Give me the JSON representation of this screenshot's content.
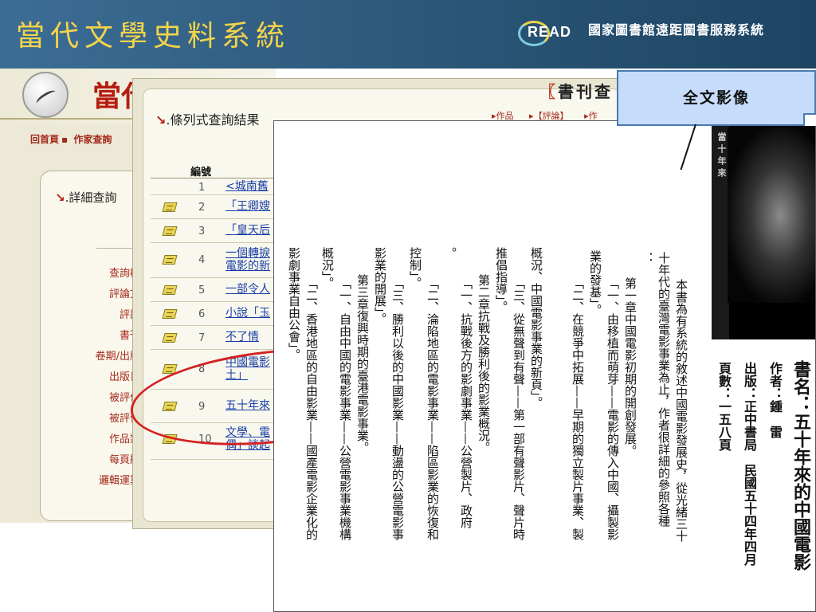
{
  "header": {
    "title": "當代文學史料系統",
    "logo_text": "READ",
    "agency": "國家圖書館遠距圖書服務系統"
  },
  "left_panel": {
    "site_title": "當代",
    "breadcrumb": [
      "回首頁",
      "作家查詢"
    ],
    "detail_heading": "詳細查詢",
    "field_labels": [
      "查詢模",
      "評論文",
      "評論",
      "書刊",
      "卷期/出版",
      "出版日",
      "被評作",
      "被評作",
      "作品類",
      "每頁顯",
      "邏輯運算"
    ]
  },
  "results_panel": {
    "heading": "條列式查詢結果",
    "book_tag": "書刊查",
    "tabs": [
      "作品",
      "【評論】",
      "作"
    ],
    "col_number": "編號",
    "rows": [
      {
        "no": "1",
        "title": "<城南舊",
        "icon": false
      },
      {
        "no": "2",
        "title": "「王卿嫂",
        "icon": true
      },
      {
        "no": "3",
        "title": "「皇天后",
        "icon": true
      },
      {
        "no": "4",
        "title": "一個轉捩\n電影的新",
        "icon": true
      },
      {
        "no": "5",
        "title": "一部令人",
        "icon": true
      },
      {
        "no": "6",
        "title": "小說「玉",
        "icon": true
      },
      {
        "no": "7",
        "title": "不了情",
        "icon": true
      },
      {
        "no": "8",
        "title": "中國電影\n土」",
        "icon": true
      },
      {
        "no": "9",
        "title": "五十年來",
        "icon": true
      },
      {
        "no": "10",
        "title": "文學、電\n偶」談起",
        "icon": true
      }
    ]
  },
  "document": {
    "book_title": "書名：五十年來的中國電影",
    "author": "作者：鍾　雷",
    "publisher": "出版：正中書局　民國五十四年四月",
    "pages": "頁數：一五八頁",
    "columns": [
      "本書為有系統的敘述中國電影發展史，從光緒三十",
      "十年代的臺灣電影事業為止，作者很詳細的參照各種",
      "：",
      "第一章中國電影初期的開創發展。",
      "「一、由移植而萌芽——電影的傳入中國、攝製影",
      "業的發基」。",
      "「二、在競爭中拓展——早期的獨立製片事業、製",
      "概況、中國電影事業的新頁」。",
      "「三、從無聲到有聲——第一部有聲影片、聲片時",
      "推倡指導」。",
      "第二章抗戰及勝利後的影業概況。",
      "「一、抗戰後方的影劇事業——公營製片、政府",
      "。",
      "「二、淪陷地區的電影事業——陷區影業的恢復和",
      "控制」。",
      "「三、勝利以後的中國影業——動盪的公營電影事",
      "影業的開展」。",
      "第三章復興時期的臺港電影事業。",
      "「一、自由中國的電影事業——公營電影事業機構",
      "概況」。",
      "「二、香港地區的自由影業——國產電影企業化的",
      "影劇事業自由公會」。"
    ]
  },
  "callout": {
    "label": "全文影像"
  },
  "colors": {
    "header_bg": "#2f5c80",
    "header_title": "#f5d44a",
    "link": "#1a3fa6",
    "accent_red": "#b51d12",
    "callout_bg": "#c6dcfa"
  }
}
